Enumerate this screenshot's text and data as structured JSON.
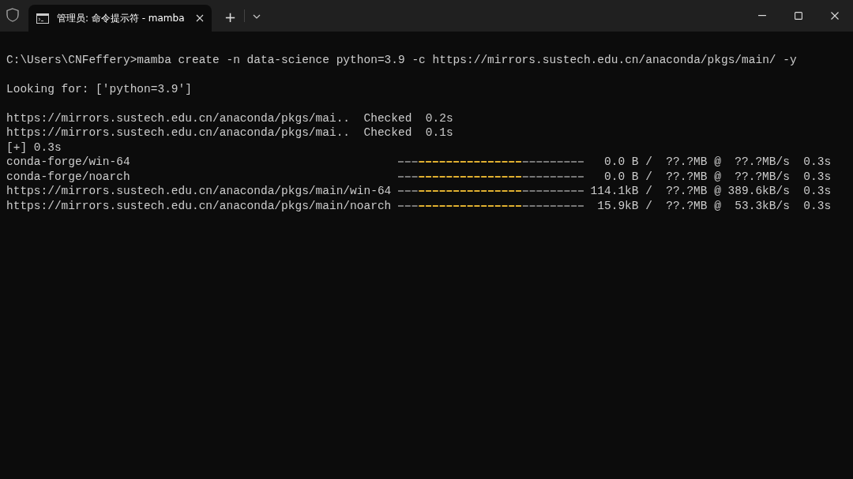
{
  "tab": {
    "title": "管理员: 命令提示符 - mamba",
    "selected": true
  },
  "new_tab": "+",
  "lines": [
    {
      "kind": "blank"
    },
    {
      "kind": "text",
      "text": "C:\\Users\\CNFeffery>mamba create -n data-science python=3.9 -c https://mirrors.sustech.edu.cn/anaconda/pkgs/main/ -y"
    },
    {
      "kind": "blank"
    },
    {
      "kind": "text",
      "text": "Looking for: ['python=3.9']"
    },
    {
      "kind": "blank"
    },
    {
      "kind": "checked",
      "source": "https://mirrors.sustech.edu.cn/anaconda/pkgs/mai..",
      "status": "Checked",
      "time": "0.2s"
    },
    {
      "kind": "checked",
      "source": "https://mirrors.sustech.edu.cn/anaconda/pkgs/mai..",
      "status": "Checked",
      "time": "0.1s"
    },
    {
      "kind": "text",
      "text": "[+] 0.3s"
    },
    {
      "kind": "download",
      "source": "conda-forge/win-64",
      "stats": "0.0 B /  ??.?MB @  ??.?MB/s  0.3s"
    },
    {
      "kind": "download",
      "source": "conda-forge/noarch",
      "stats": "0.0 B /  ??.?MB @  ??.?MB/s  0.3s"
    },
    {
      "kind": "download",
      "source": "https://mirrors.sustech.edu.cn/anaconda/pkgs/main/win-64",
      "stats": "114.1kB /  ??.?MB @ 389.6kB/s  0.3s"
    },
    {
      "kind": "download",
      "source": "https://mirrors.sustech.edu.cn/anaconda/pkgs/main/noarch",
      "stats": "15.9kB /  ??.?MB @  53.3kB/s  0.3s"
    }
  ]
}
